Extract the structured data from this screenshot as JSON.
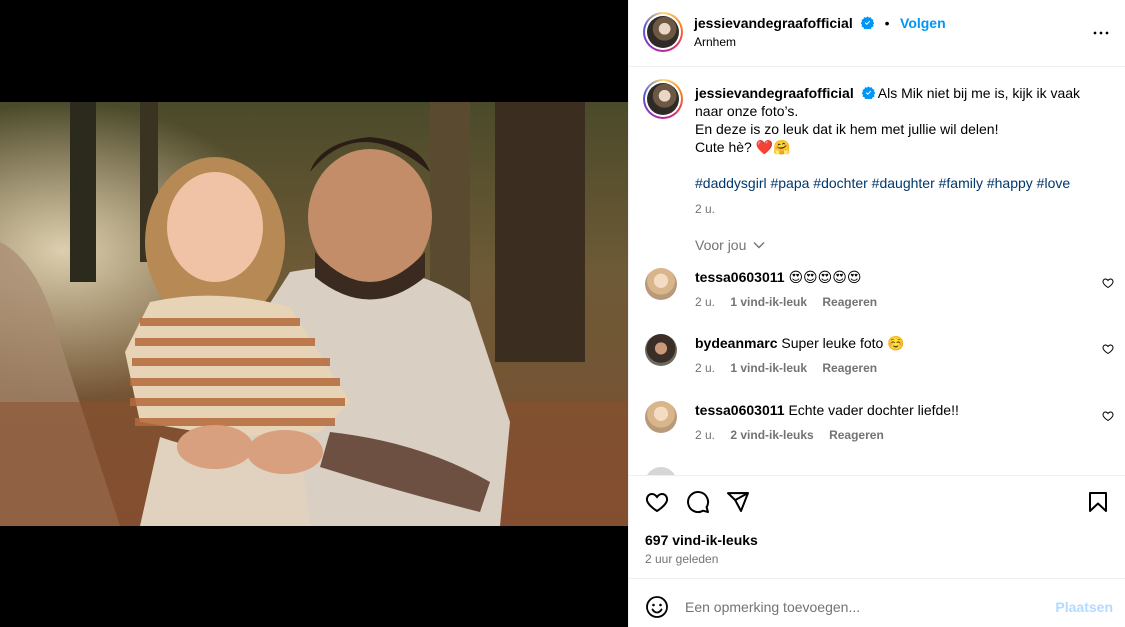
{
  "header": {
    "username": "jessievandegraafofficial",
    "follow_label": "Volgen",
    "separator": "•",
    "location": "Arnhem"
  },
  "caption": {
    "username": "jessievandegraafofficial",
    "line1": "Als Mik niet bij me is, kijk ik vaak naar onze foto’s.",
    "line2": "En deze is zo leuk dat ik hem met jullie wil delen!",
    "line3": "Cute hè? ❤️🤗",
    "hashtags": "#daddysgirl #papa #dochter #daughter #family #happy #love",
    "time": "2 u."
  },
  "sort_label": "Voor jou",
  "comments": [
    {
      "username": "tessa0603011",
      "text": "😍😍😍😍😍",
      "time": "2 u.",
      "likes": "1 vind-ik-leuk",
      "reply": "Reageren"
    },
    {
      "username": "bydeanmarc",
      "text": "Super leuke foto ☺️",
      "time": "2 u.",
      "likes": "1 vind-ik-leuk",
      "reply": "Reageren"
    },
    {
      "username": "tessa0603011",
      "text": "Echte vader dochter liefde!!",
      "time": "2 u.",
      "likes": "2 vind-ik-leuks",
      "reply": "Reageren"
    }
  ],
  "engagement": {
    "likes": "697 vind-ik-leuks",
    "time": "2 uur geleden"
  },
  "add_comment": {
    "placeholder": "Een opmerking toevoegen...",
    "post_label": "Plaatsen"
  },
  "colors": {
    "accent": "#0095f6",
    "hashtag": "#00376b",
    "muted": "#737373",
    "post_disabled": "#b3dbff"
  },
  "icons": [
    "verified-badge-icon",
    "more-options-icon",
    "heart-icon",
    "comment-icon",
    "share-icon",
    "bookmark-icon",
    "emoji-icon",
    "chevron-down-icon"
  ]
}
